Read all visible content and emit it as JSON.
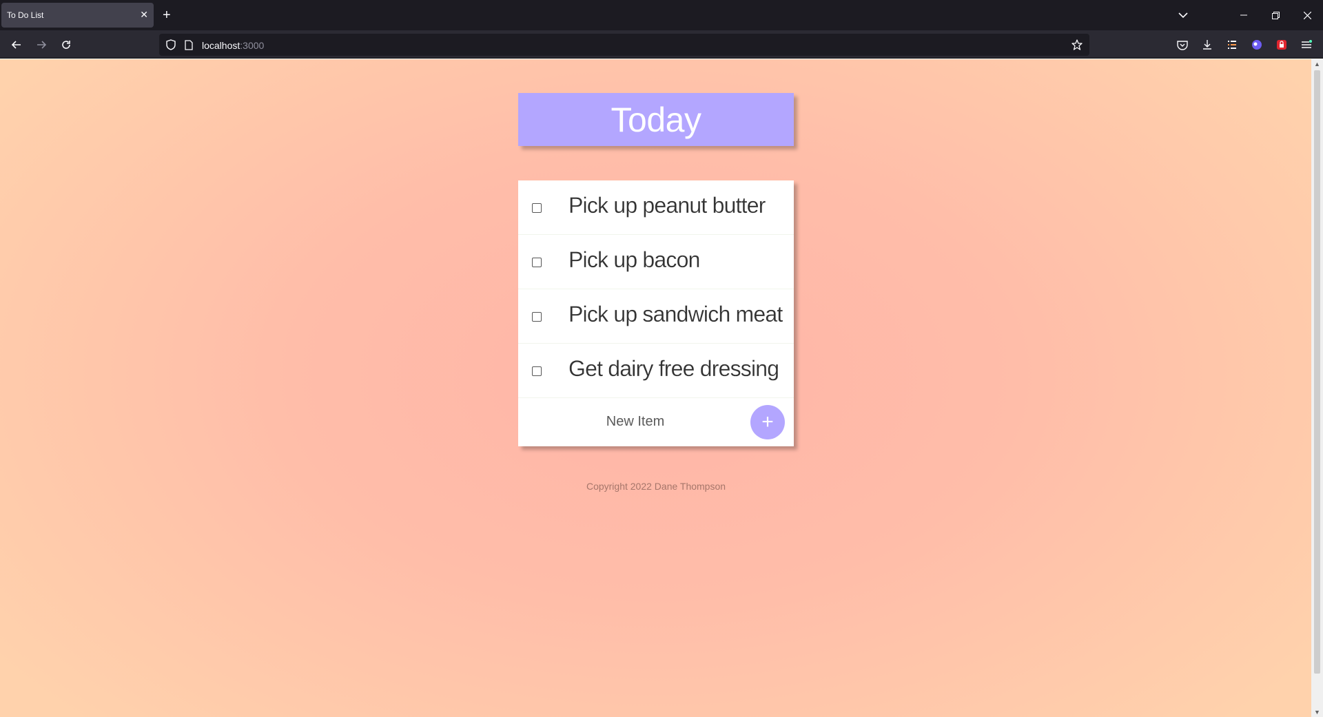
{
  "browser": {
    "tab_title": "To Do List",
    "url_host": "localhost",
    "url_port": ":3000"
  },
  "page": {
    "heading": "Today",
    "items": [
      {
        "label": "Pick up peanut butter"
      },
      {
        "label": "Pick up bacon"
      },
      {
        "label": "Pick up sandwich meat"
      },
      {
        "label": "Get dairy free dressing"
      }
    ],
    "new_item_placeholder": "New Item",
    "add_button_label": "+",
    "footer": "Copyright 2022 Dane Thompson"
  },
  "colors": {
    "accent": "#b3a6ff",
    "background_center": "#ffb5a8",
    "background_edge": "#ffd2ac"
  }
}
